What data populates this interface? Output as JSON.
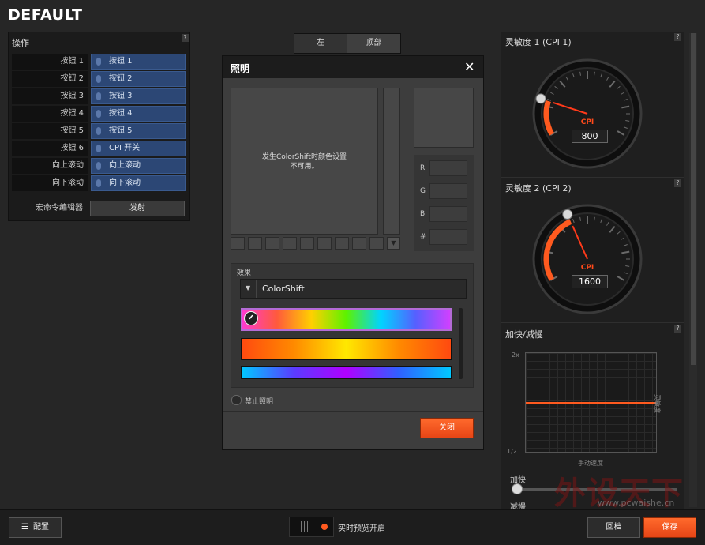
{
  "profile_title": "DEFAULT",
  "actions": {
    "title": "操作",
    "help": "?",
    "rows": [
      {
        "label": "按钮 1",
        "value": "按钮 1"
      },
      {
        "label": "按钮 2",
        "value": "按钮 2"
      },
      {
        "label": "按钮 3",
        "value": "按钮 3"
      },
      {
        "label": "按钮 4",
        "value": "按钮 4"
      },
      {
        "label": "按钮 5",
        "value": "按钮 5"
      },
      {
        "label": "按钮 6",
        "value": "CPI 开关"
      },
      {
        "label": "向上滚动",
        "value": "向上滚动"
      },
      {
        "label": "向下滚动",
        "value": "向下滚动"
      }
    ],
    "macro_label": "宏命令编辑器",
    "macro_button": "发射"
  },
  "tabs": [
    {
      "label": "左"
    },
    {
      "label": "顶部"
    }
  ],
  "lighting_dialog": {
    "title": "照明",
    "close_symbol": "✕",
    "notice": "发生ColorShift时颜色设置\n不可用。",
    "rgb_labels": [
      "R",
      "G",
      "B",
      "#"
    ],
    "effects_label": "效果",
    "effect_selected": "ColorShift",
    "disable_lighting_label": "禁止照明",
    "close_button": "关闭",
    "swatch_count": 9
  },
  "sensitivity1": {
    "title": "灵敏度 1 (CPI 1)",
    "unit": "CPI",
    "value": "800",
    "level": 0.2
  },
  "sensitivity2": {
    "title": "灵敏度 2 (CPI 2)",
    "unit": "CPI",
    "value": "1600",
    "level": 0.4
  },
  "acceleration": {
    "title": "加快/减慢",
    "y_top": "2x",
    "y_bottom": "1/2",
    "y_axis_label": "灵敏度",
    "x_axis_label": "手动速度",
    "slider_top_label": "加快",
    "slider_bottom_label": "减慢",
    "level": 0
  },
  "bottom": {
    "config_button": "配置",
    "live_preview": "实时预览开启",
    "revert_button": "回档",
    "save_button": "保存"
  },
  "watermark": {
    "text": "外设天下",
    "url": "www.pcwaishe.cn"
  },
  "colors": {
    "accent": "#ff5a1f",
    "blue_value": "#2c4775",
    "background": "#262626"
  }
}
